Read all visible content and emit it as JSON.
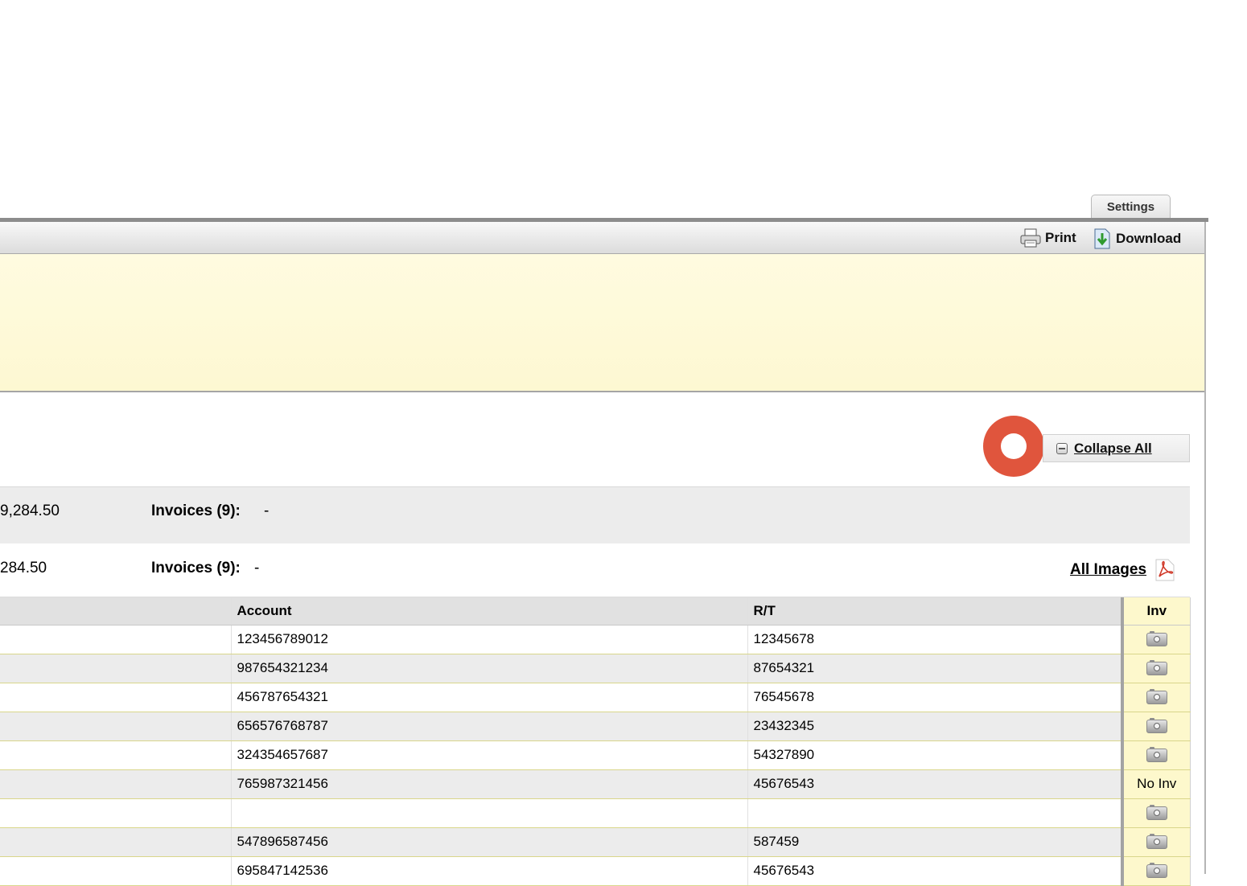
{
  "settings_tab": "Settings",
  "toolbar": {
    "print": "Print",
    "download": "Download"
  },
  "collapse_all": "Collapse All",
  "summary": [
    {
      "amount": "9,284.50",
      "invoices_label": "Invoices (9):",
      "invoices_value": "-"
    },
    {
      "amount": "284.50",
      "invoices_label": "Invoices (9):",
      "invoices_value": "-"
    }
  ],
  "all_images": "All Images",
  "table": {
    "headers": {
      "account": "Account",
      "rt": "R/T",
      "inv": "Inv"
    },
    "rows": [
      {
        "account": "123456789012",
        "rt": "12345678",
        "inv": "camera-icon"
      },
      {
        "account": "987654321234",
        "rt": "87654321",
        "inv": "camera-icon"
      },
      {
        "account": "456787654321",
        "rt": "76545678",
        "inv": "camera-icon"
      },
      {
        "account": "656576768787",
        "rt": "23432345",
        "inv": "camera-icon"
      },
      {
        "account": "324354657687",
        "rt": "54327890",
        "inv": "camera-icon"
      },
      {
        "account": "765987321456",
        "rt": "45676543",
        "inv": "No Inv"
      },
      {
        "account": "",
        "rt": "",
        "inv": "camera-icon"
      },
      {
        "account": "547896587456",
        "rt": "587459",
        "inv": "camera-icon"
      },
      {
        "account": "695847142536",
        "rt": "45676543",
        "inv": "camera-icon"
      }
    ]
  }
}
